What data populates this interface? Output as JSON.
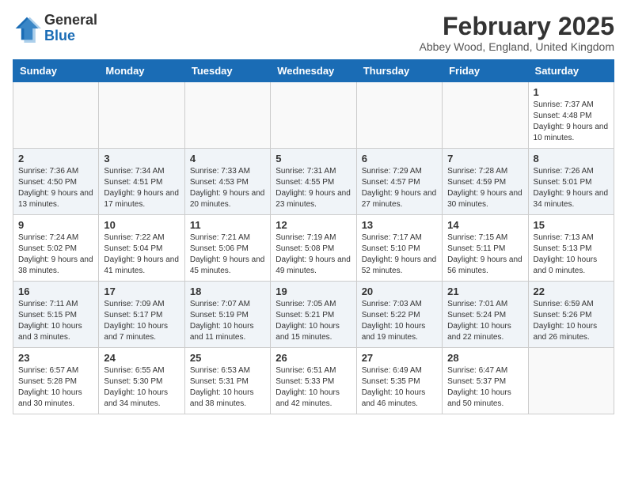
{
  "logo": {
    "general": "General",
    "blue": "Blue"
  },
  "title": "February 2025",
  "subtitle": "Abbey Wood, England, United Kingdom",
  "weekdays": [
    "Sunday",
    "Monday",
    "Tuesday",
    "Wednesday",
    "Thursday",
    "Friday",
    "Saturday"
  ],
  "weeks": [
    [
      {
        "day": "",
        "info": ""
      },
      {
        "day": "",
        "info": ""
      },
      {
        "day": "",
        "info": ""
      },
      {
        "day": "",
        "info": ""
      },
      {
        "day": "",
        "info": ""
      },
      {
        "day": "",
        "info": ""
      },
      {
        "day": "1",
        "info": "Sunrise: 7:37 AM\nSunset: 4:48 PM\nDaylight: 9 hours and 10 minutes."
      }
    ],
    [
      {
        "day": "2",
        "info": "Sunrise: 7:36 AM\nSunset: 4:50 PM\nDaylight: 9 hours and 13 minutes."
      },
      {
        "day": "3",
        "info": "Sunrise: 7:34 AM\nSunset: 4:51 PM\nDaylight: 9 hours and 17 minutes."
      },
      {
        "day": "4",
        "info": "Sunrise: 7:33 AM\nSunset: 4:53 PM\nDaylight: 9 hours and 20 minutes."
      },
      {
        "day": "5",
        "info": "Sunrise: 7:31 AM\nSunset: 4:55 PM\nDaylight: 9 hours and 23 minutes."
      },
      {
        "day": "6",
        "info": "Sunrise: 7:29 AM\nSunset: 4:57 PM\nDaylight: 9 hours and 27 minutes."
      },
      {
        "day": "7",
        "info": "Sunrise: 7:28 AM\nSunset: 4:59 PM\nDaylight: 9 hours and 30 minutes."
      },
      {
        "day": "8",
        "info": "Sunrise: 7:26 AM\nSunset: 5:01 PM\nDaylight: 9 hours and 34 minutes."
      }
    ],
    [
      {
        "day": "9",
        "info": "Sunrise: 7:24 AM\nSunset: 5:02 PM\nDaylight: 9 hours and 38 minutes."
      },
      {
        "day": "10",
        "info": "Sunrise: 7:22 AM\nSunset: 5:04 PM\nDaylight: 9 hours and 41 minutes."
      },
      {
        "day": "11",
        "info": "Sunrise: 7:21 AM\nSunset: 5:06 PM\nDaylight: 9 hours and 45 minutes."
      },
      {
        "day": "12",
        "info": "Sunrise: 7:19 AM\nSunset: 5:08 PM\nDaylight: 9 hours and 49 minutes."
      },
      {
        "day": "13",
        "info": "Sunrise: 7:17 AM\nSunset: 5:10 PM\nDaylight: 9 hours and 52 minutes."
      },
      {
        "day": "14",
        "info": "Sunrise: 7:15 AM\nSunset: 5:11 PM\nDaylight: 9 hours and 56 minutes."
      },
      {
        "day": "15",
        "info": "Sunrise: 7:13 AM\nSunset: 5:13 PM\nDaylight: 10 hours and 0 minutes."
      }
    ],
    [
      {
        "day": "16",
        "info": "Sunrise: 7:11 AM\nSunset: 5:15 PM\nDaylight: 10 hours and 3 minutes."
      },
      {
        "day": "17",
        "info": "Sunrise: 7:09 AM\nSunset: 5:17 PM\nDaylight: 10 hours and 7 minutes."
      },
      {
        "day": "18",
        "info": "Sunrise: 7:07 AM\nSunset: 5:19 PM\nDaylight: 10 hours and 11 minutes."
      },
      {
        "day": "19",
        "info": "Sunrise: 7:05 AM\nSunset: 5:21 PM\nDaylight: 10 hours and 15 minutes."
      },
      {
        "day": "20",
        "info": "Sunrise: 7:03 AM\nSunset: 5:22 PM\nDaylight: 10 hours and 19 minutes."
      },
      {
        "day": "21",
        "info": "Sunrise: 7:01 AM\nSunset: 5:24 PM\nDaylight: 10 hours and 22 minutes."
      },
      {
        "day": "22",
        "info": "Sunrise: 6:59 AM\nSunset: 5:26 PM\nDaylight: 10 hours and 26 minutes."
      }
    ],
    [
      {
        "day": "23",
        "info": "Sunrise: 6:57 AM\nSunset: 5:28 PM\nDaylight: 10 hours and 30 minutes."
      },
      {
        "day": "24",
        "info": "Sunrise: 6:55 AM\nSunset: 5:30 PM\nDaylight: 10 hours and 34 minutes."
      },
      {
        "day": "25",
        "info": "Sunrise: 6:53 AM\nSunset: 5:31 PM\nDaylight: 10 hours and 38 minutes."
      },
      {
        "day": "26",
        "info": "Sunrise: 6:51 AM\nSunset: 5:33 PM\nDaylight: 10 hours and 42 minutes."
      },
      {
        "day": "27",
        "info": "Sunrise: 6:49 AM\nSunset: 5:35 PM\nDaylight: 10 hours and 46 minutes."
      },
      {
        "day": "28",
        "info": "Sunrise: 6:47 AM\nSunset: 5:37 PM\nDaylight: 10 hours and 50 minutes."
      },
      {
        "day": "",
        "info": ""
      }
    ]
  ]
}
